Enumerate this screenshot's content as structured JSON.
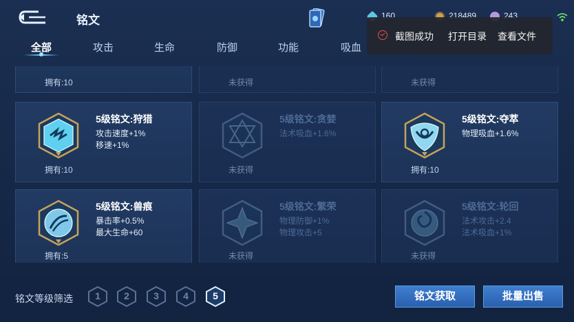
{
  "header": {
    "title": "铭文",
    "wifi_icon": "wifi-icon"
  },
  "resources": [
    {
      "name": "gem",
      "value": "160",
      "color": "#5fc6e0"
    },
    {
      "name": "coin",
      "value": "218489",
      "color": "#c9a25a"
    },
    {
      "name": "crystal",
      "value": "243",
      "color": "#b59ad8"
    }
  ],
  "tabs": [
    {
      "label": "全部",
      "active": true
    },
    {
      "label": "攻击"
    },
    {
      "label": "生命"
    },
    {
      "label": "防御"
    },
    {
      "label": "功能"
    },
    {
      "label": "吸血"
    }
  ],
  "toast": {
    "message": "截图成功",
    "action_open": "打开目录",
    "action_view": "查看文件"
  },
  "cards": [
    {
      "own": "拥有:10",
      "owned": true
    },
    {
      "own": "未获得",
      "owned": false
    },
    {
      "own": "未获得",
      "owned": false
    },
    {
      "name": "5级铭文:狩猎",
      "stat1": "攻击速度+1%",
      "stat2": "移速+1%",
      "own": "拥有:10",
      "owned": true,
      "accent": "#5fd0f0"
    },
    {
      "name": "5级铭文:贪婪",
      "stat1": "法术吸血+1.6%",
      "stat2": "",
      "own": "未获得",
      "owned": false,
      "accent": "#6aa8d0"
    },
    {
      "name": "5级铭文:夺萃",
      "stat1": "物理吸血+1.6%",
      "stat2": "",
      "own": "拥有:10",
      "owned": true,
      "accent": "#8fd8ef"
    },
    {
      "name": "5级铭文:兽痕",
      "stat1": "暴击率+0.5%",
      "stat2": "最大生命+60",
      "own": "拥有:5",
      "owned": true,
      "accent": "#7fc8ea"
    },
    {
      "name": "5级铭文:繁荣",
      "stat1": "物理防御+1%",
      "stat2": "物理攻击+5",
      "own": "未获得",
      "owned": false,
      "accent": "#6aa8d0"
    },
    {
      "name": "5级铭文:轮回",
      "stat1": "法术攻击+2.4",
      "stat2": "法术吸血+1%",
      "own": "未获得",
      "owned": false,
      "accent": "#6aa8d0"
    }
  ],
  "filter": {
    "label": "铭文等级筛选",
    "levels": [
      "1",
      "2",
      "3",
      "4",
      "5"
    ],
    "selected": "5"
  },
  "buttons": {
    "acquire": "铭文获取",
    "sell": "批量出售"
  }
}
